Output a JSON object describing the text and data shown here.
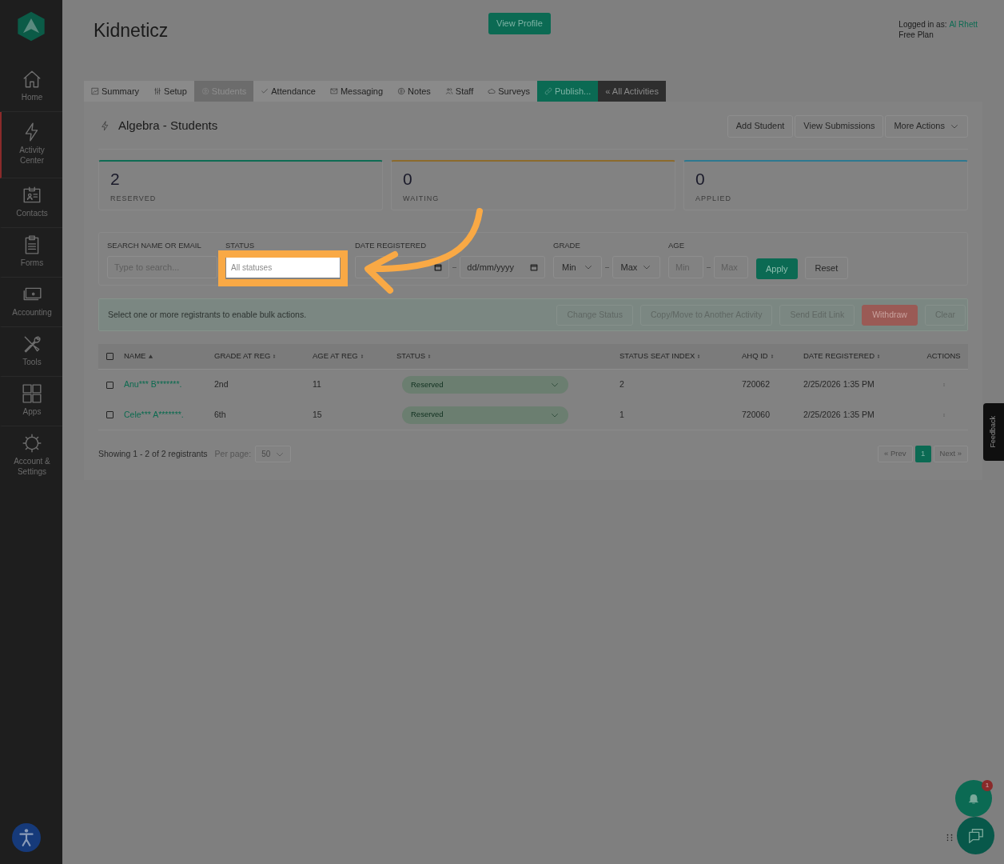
{
  "sidebar": {
    "items": [
      {
        "label": "Home",
        "selected": false
      },
      {
        "label": "Activity Center",
        "selected": true
      },
      {
        "label": "Contacts",
        "selected": false
      },
      {
        "label": "Forms",
        "selected": false
      },
      {
        "label": "Accounting",
        "selected": false
      },
      {
        "label": "Tools",
        "selected": false
      },
      {
        "label": "Apps",
        "selected": false
      },
      {
        "label": "Account & Settings",
        "selected": false
      }
    ]
  },
  "header": {
    "title": "Kidneticz",
    "view_profile": "View Profile",
    "logged_in_label": "Logged in as:",
    "user": "Al Rhett",
    "plan": "Free Plan"
  },
  "tabs": [
    {
      "label": "Summary",
      "kind": "normal",
      "selected": false
    },
    {
      "label": "Setup",
      "kind": "normal",
      "selected": false
    },
    {
      "label": "Students",
      "kind": "normal",
      "selected": true
    },
    {
      "label": "Attendance",
      "kind": "normal",
      "selected": false
    },
    {
      "label": "Messaging",
      "kind": "normal",
      "selected": false
    },
    {
      "label": "Notes",
      "kind": "normal",
      "selected": false
    },
    {
      "label": "Staff",
      "kind": "normal",
      "selected": false
    },
    {
      "label": "Surveys",
      "kind": "normal",
      "selected": false
    },
    {
      "label": "Publish...",
      "kind": "publish",
      "selected": false
    },
    {
      "label": "« All Activities",
      "kind": "back",
      "selected": false
    }
  ],
  "page_title": "Algebra - Students",
  "actions": [
    {
      "label": "Add Student",
      "dropdown": false
    },
    {
      "label": "View Submissions",
      "dropdown": false
    },
    {
      "label": "More Actions",
      "dropdown": true
    }
  ],
  "stats": [
    {
      "value": "2",
      "label": "RESERVED",
      "color": "#0e6b53"
    },
    {
      "value": "0",
      "label": "WAITING",
      "color": "#8c6a2c"
    },
    {
      "value": "0",
      "label": "APPLIED",
      "color": "#2d7890"
    }
  ],
  "filters": {
    "search_label": "SEARCH NAME OR EMAIL",
    "search_placeholder": "Type to search...",
    "status_label": "STATUS",
    "status_placeholder": "All statuses",
    "date_label": "DATE REGISTERED",
    "date_to_placeholder": "dd/mm/yyyy",
    "grade_label": "GRADE",
    "grade_min": "Min",
    "grade_max": "Max",
    "age_label": "AGE",
    "age_min_placeholder": "Min",
    "age_max_placeholder": "Max",
    "apply": "Apply",
    "reset": "Reset"
  },
  "bulk": {
    "message": "Select one or more registrants to enable bulk actions.",
    "buttons": [
      {
        "label": "Change Status",
        "kind": "normal"
      },
      {
        "label": "Copy/Move to Another Activity",
        "kind": "normal"
      },
      {
        "label": "Send Edit Link",
        "kind": "normal"
      },
      {
        "label": "Withdraw",
        "kind": "danger"
      },
      {
        "label": "Clear",
        "kind": "normal"
      }
    ]
  },
  "table": {
    "select_all_checked": false,
    "columns": [
      {
        "label": "NAME",
        "kind": "sorted"
      },
      {
        "label": "GRADE AT REG",
        "kind": "sortable"
      },
      {
        "label": "AGE AT REG",
        "kind": "sortable"
      },
      {
        "label": "STATUS",
        "kind": "sortable"
      },
      {
        "label": "STATUS SEAT INDEX",
        "kind": "sortable"
      },
      {
        "label": "AHQ ID",
        "kind": "sortable"
      },
      {
        "label": "DATE REGISTERED",
        "kind": "sortable"
      },
      {
        "label": "ACTIONS",
        "kind": "plain"
      }
    ],
    "rows": [
      {
        "checked": false,
        "name": "Anu*** B*******.",
        "grade": "2nd",
        "age": "11",
        "status": "Reserved",
        "seat_index": "2",
        "ahq_id": "720062",
        "date": "2/25/2026 1:35 PM"
      },
      {
        "checked": false,
        "name": "Cele*** A*******.",
        "grade": "6th",
        "age": "15",
        "status": "Reserved",
        "seat_index": "1",
        "ahq_id": "720060",
        "date": "2/25/2026 1:35 PM"
      }
    ]
  },
  "footer": {
    "showing": "Showing 1 - 2 of 2 registrants",
    "per_page_label": "Per page:",
    "per_page": "50",
    "prev": "« Prev",
    "pages": [
      {
        "label": "1",
        "selected": true
      }
    ],
    "next": "Next »"
  },
  "feedback": "Feedback",
  "notifications": {
    "badge": "1"
  }
}
